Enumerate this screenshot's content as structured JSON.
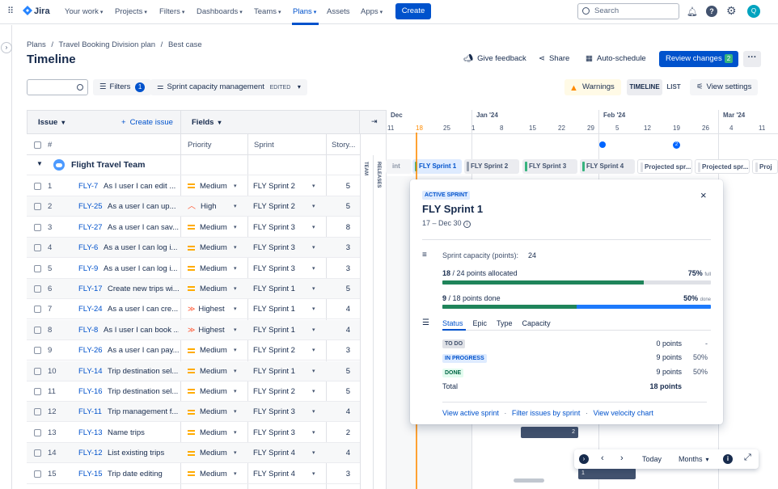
{
  "nav": {
    "product": "Jira",
    "items": [
      "Your work",
      "Projects",
      "Filters",
      "Dashboards",
      "Teams",
      "Plans",
      "Assets",
      "Apps"
    ],
    "create": "Create",
    "search_placeholder": "Search",
    "avatar_initial": "Q"
  },
  "page": {
    "breadcrumb": [
      "Plans",
      "Travel Booking Division plan",
      "Best case"
    ],
    "title": "Timeline",
    "give_feedback": "Give feedback",
    "share": "Share",
    "auto_schedule": "Auto-schedule",
    "review_changes": "Review changes",
    "review_count": "2"
  },
  "toolbar": {
    "filters": "Filters",
    "filters_count": "1",
    "view_label": "Sprint capacity management",
    "edited": "EDITED",
    "warnings": "Warnings",
    "timeline": "TIMELINE",
    "list": "LIST",
    "view_settings": "View settings"
  },
  "table": {
    "issue_header": "Issue",
    "create_issue": "Create issue",
    "fields_header": "Fields",
    "columns": [
      "#",
      "Priority",
      "Sprint",
      "Story..."
    ],
    "team_name": "Flight Travel Team",
    "rows": [
      {
        "n": "1",
        "key": "FLY-7",
        "summary": "As I user I can edit ...",
        "priority": "Medium",
        "sprint": "FLY Sprint 2",
        "points": "5"
      },
      {
        "n": "2",
        "key": "FLY-25",
        "summary": "As a user I can up...",
        "priority": "High",
        "sprint": "FLY Sprint 2",
        "points": "5"
      },
      {
        "n": "3",
        "key": "FLY-27",
        "summary": "As a user I can sav...",
        "priority": "Medium",
        "sprint": "FLY Sprint 3",
        "points": "8"
      },
      {
        "n": "4",
        "key": "FLY-6",
        "summary": "As a user I can log i...",
        "priority": "Medium",
        "sprint": "FLY Sprint 3",
        "points": "3"
      },
      {
        "n": "5",
        "key": "FLY-9",
        "summary": "As a user I can log i...",
        "priority": "Medium",
        "sprint": "FLY Sprint 3",
        "points": "3"
      },
      {
        "n": "6",
        "key": "FLY-17",
        "summary": "Create new trips wi...",
        "priority": "Medium",
        "sprint": "FLY Sprint 1",
        "points": "5"
      },
      {
        "n": "7",
        "key": "FLY-24",
        "summary": "As a user I can cre...",
        "priority": "Highest",
        "sprint": "FLY Sprint 1",
        "points": "4"
      },
      {
        "n": "8",
        "key": "FLY-8",
        "summary": "As I user I can book ...",
        "priority": "Highest",
        "sprint": "FLY Sprint 1",
        "points": "4"
      },
      {
        "n": "9",
        "key": "FLY-26",
        "summary": "As a user I can pay...",
        "priority": "Medium",
        "sprint": "FLY Sprint 2",
        "points": "3"
      },
      {
        "n": "10",
        "key": "FLY-14",
        "summary": "Trip destination sel...",
        "priority": "Medium",
        "sprint": "FLY Sprint 1",
        "points": "5"
      },
      {
        "n": "11",
        "key": "FLY-16",
        "summary": "Trip destination sel...",
        "priority": "Medium",
        "sprint": "FLY Sprint 2",
        "points": "5"
      },
      {
        "n": "12",
        "key": "FLY-11",
        "summary": "Trip management f...",
        "priority": "Medium",
        "sprint": "FLY Sprint 3",
        "points": "4"
      },
      {
        "n": "13",
        "key": "FLY-13",
        "summary": "Name trips",
        "priority": "Medium",
        "sprint": "FLY Sprint 3",
        "points": "2"
      },
      {
        "n": "14",
        "key": "FLY-12",
        "summary": "List existing trips",
        "priority": "Medium",
        "sprint": "FLY Sprint 4",
        "points": "4"
      },
      {
        "n": "15",
        "key": "FLY-15",
        "summary": "Trip date editing",
        "priority": "Medium",
        "sprint": "FLY Sprint 4",
        "points": "3"
      }
    ]
  },
  "side_labels": {
    "team": "TEAM",
    "releases": "RELEASES"
  },
  "timeline": {
    "months": [
      "Dec",
      "Jan '24",
      "Feb '24",
      "Mar '24"
    ],
    "days": [
      "11",
      "18",
      "25",
      "1",
      "8",
      "15",
      "22",
      "29",
      "5",
      "12",
      "19",
      "26",
      "4",
      "11"
    ],
    "release_marker": "2",
    "sprints": [
      "int",
      "FLY Sprint 1",
      "FLY Sprint 2",
      "FLY Sprint 3",
      "FLY Sprint 4",
      "Projected spr...",
      "Projected spr...",
      "Proj"
    ],
    "bar_counts": [
      "2",
      "1"
    ]
  },
  "popup": {
    "status": "ACTIVE SPRINT",
    "name": "FLY Sprint 1",
    "dates": "17 – Dec 30",
    "capacity_label": "Sprint capacity (points):",
    "capacity_value": "24",
    "allocated_num": "18",
    "allocated_text": "/ 24 points allocated",
    "allocated_pct": "75%",
    "allocated_suffix": "full",
    "allocated_fraction": 0.75,
    "done_num": "9",
    "done_text": "/ 18 points done",
    "done_pct": "50%",
    "done_suffix": "done",
    "done_fraction": 0.5,
    "tabs": [
      "Status",
      "Epic",
      "Type",
      "Capacity"
    ],
    "statuses": [
      {
        "label": "TO DO",
        "points": "0 points",
        "pct": "-"
      },
      {
        "label": "IN PROGRESS",
        "points": "9 points",
        "pct": "50%"
      },
      {
        "label": "DONE",
        "points": "9 points",
        "pct": "50%"
      }
    ],
    "total_label": "Total",
    "total_value": "18 points",
    "links": [
      "View active sprint",
      "Filter issues by sprint",
      "View velocity chart"
    ]
  },
  "bottom": {
    "today": "Today",
    "months": "Months"
  }
}
